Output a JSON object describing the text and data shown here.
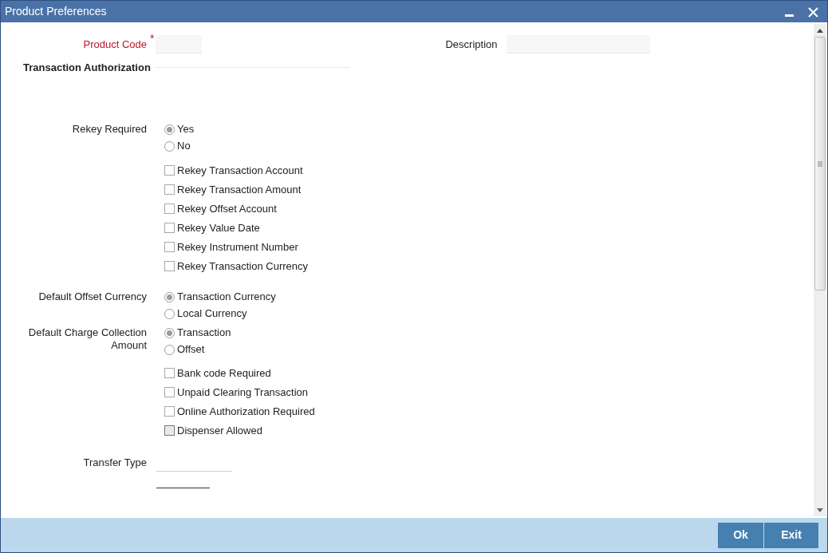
{
  "window": {
    "title": "Product Preferences"
  },
  "product_code": {
    "label": "Product Code",
    "required_mark": "*"
  },
  "description": {
    "label": "Description"
  },
  "section": {
    "title": "Transaction Authorization"
  },
  "rekey_required": {
    "label": "Rekey Required",
    "options": [
      {
        "label": "Yes",
        "selected": true
      },
      {
        "label": "No",
        "selected": false
      }
    ]
  },
  "rekey_options": [
    {
      "label": "Rekey Transaction Account",
      "checked": false
    },
    {
      "label": "Rekey Transaction Amount",
      "checked": false
    },
    {
      "label": "Rekey Offset Account",
      "checked": false
    },
    {
      "label": "Rekey Value Date",
      "checked": false
    },
    {
      "label": "Rekey Instrument Number",
      "checked": false
    },
    {
      "label": "Rekey Transaction Currency",
      "checked": false
    }
  ],
  "default_offset_currency": {
    "label": "Default Offset Currency",
    "options": [
      {
        "label": "Transaction Currency",
        "selected": true
      },
      {
        "label": "Local Currency",
        "selected": false
      }
    ]
  },
  "default_charge_collection": {
    "label": "Default Charge Collection Amount",
    "options": [
      {
        "label": "Transaction",
        "selected": true
      },
      {
        "label": "Offset",
        "selected": false
      }
    ]
  },
  "flags": [
    {
      "label": "Bank code Required",
      "checked": false,
      "focused": false
    },
    {
      "label": "Unpaid Clearing Transaction",
      "checked": false,
      "focused": false
    },
    {
      "label": "Online Authorization Required",
      "checked": false,
      "focused": false
    },
    {
      "label": "Dispenser Allowed",
      "checked": false,
      "focused": true
    }
  ],
  "transfer_type": {
    "label": "Transfer Type"
  },
  "buttons": [
    {
      "label": "Ok"
    },
    {
      "label": "Exit"
    }
  ]
}
